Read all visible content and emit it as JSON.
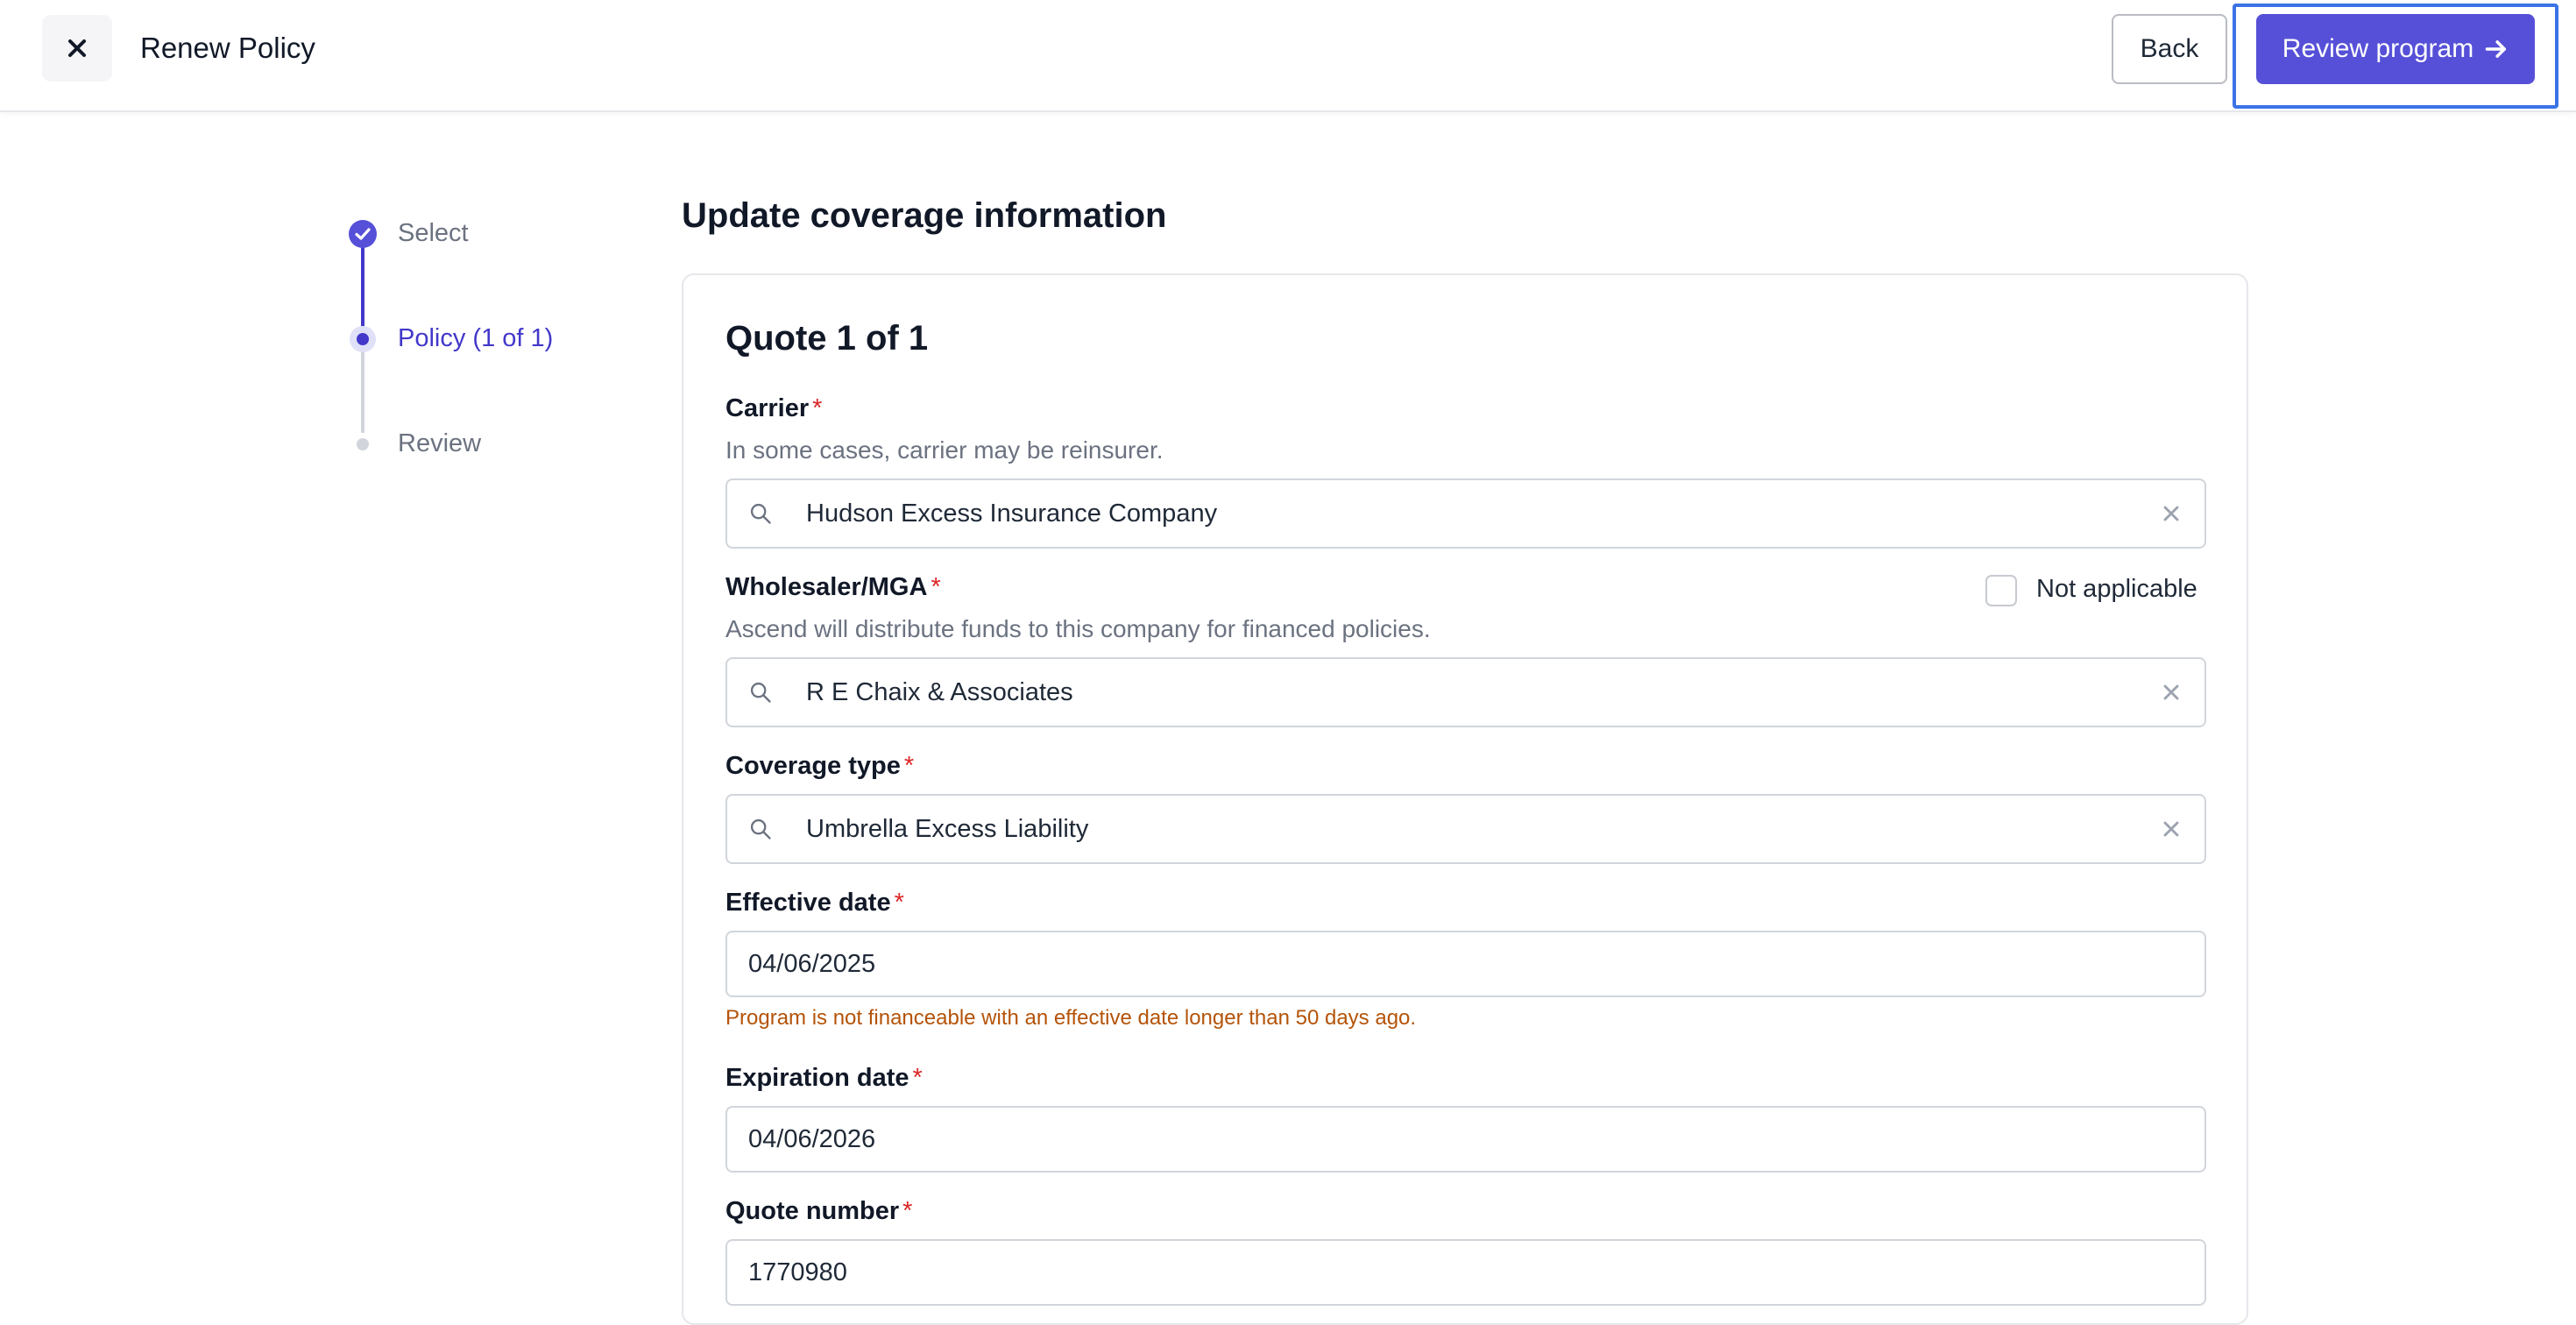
{
  "header": {
    "title": "Renew Policy",
    "back_label": "Back",
    "review_label": "Review program"
  },
  "stepper": {
    "steps": [
      {
        "label": "Select",
        "state": "complete"
      },
      {
        "label": "Policy (1 of 1)",
        "state": "current"
      },
      {
        "label": "Review",
        "state": "upcoming"
      }
    ]
  },
  "main": {
    "section_title": "Update coverage information",
    "quote_title": "Quote 1 of 1",
    "carrier": {
      "label": "Carrier",
      "helper": "In some cases, carrier may be reinsurer.",
      "value": "Hudson Excess Insurance Company"
    },
    "wholesaler": {
      "label": "Wholesaler/MGA",
      "helper": "Ascend will distribute funds to this company for financed policies.",
      "value": "R E Chaix & Associates",
      "not_applicable_label": "Not applicable"
    },
    "coverage_type": {
      "label": "Coverage type",
      "value": "Umbrella Excess Liability"
    },
    "effective_date": {
      "label": "Effective date",
      "value": "04/06/2025",
      "warning": "Program is not financeable with an effective date longer than 50 days ago."
    },
    "expiration_date": {
      "label": "Expiration date",
      "value": "04/06/2026"
    },
    "quote_number": {
      "label": "Quote number",
      "value": "1770980"
    },
    "required_marker": "*"
  },
  "colors": {
    "accent": "#5650d8",
    "focus_ring": "#3b73e6",
    "required": "#dc2626",
    "warning": "#b45309"
  }
}
